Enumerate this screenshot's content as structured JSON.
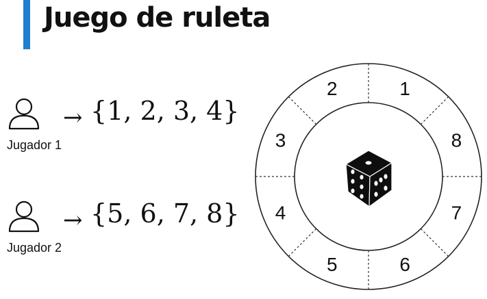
{
  "title": "Juego de ruleta",
  "accent_color": "#1e7fd0",
  "players": [
    {
      "name": "Jugador 1",
      "arrow": "→",
      "set": "{1, 2, 3, 4}",
      "icon": "user-icon"
    },
    {
      "name": "Jugador 2",
      "arrow": "→",
      "set": "{5, 6, 7, 8}",
      "icon": "user-icon"
    }
  ],
  "roulette": {
    "numbers": [
      "1",
      "8",
      "7",
      "6",
      "5",
      "4",
      "3",
      "2"
    ],
    "center_icon": "dice-icon"
  }
}
